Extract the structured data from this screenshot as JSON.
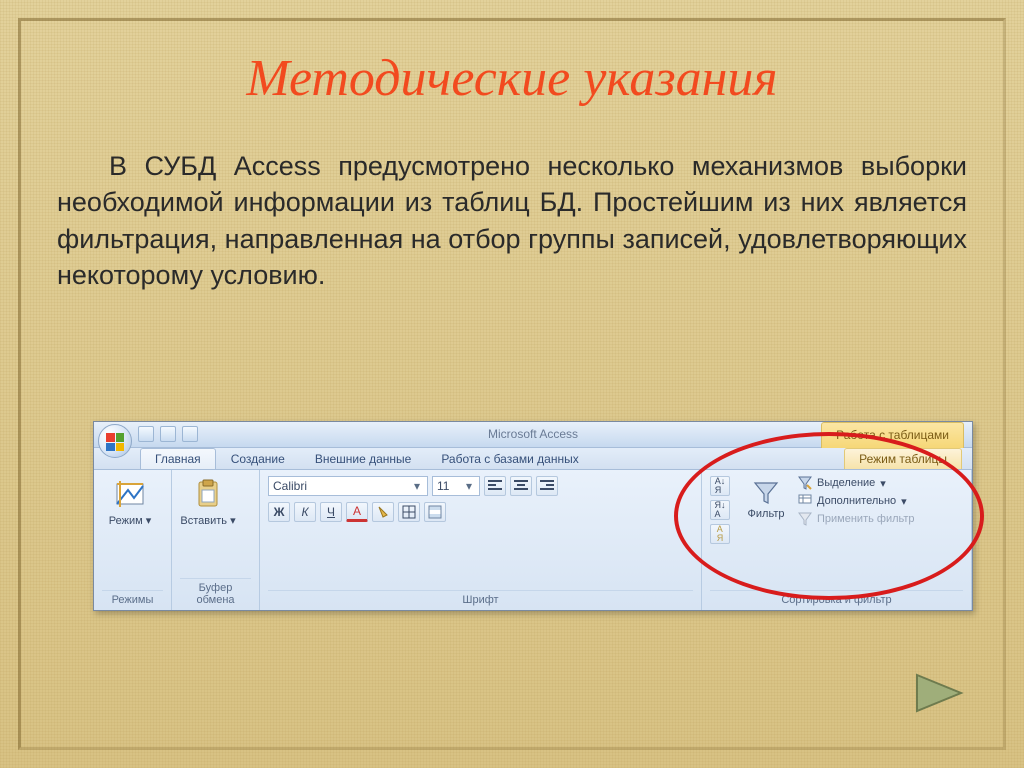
{
  "title": "Методические указания",
  "body_text": "В СУБД Access предусмотрено несколько механизмов выборки необходимой информации из таблиц БД. Простейшим из них является фильтрация, направленная на отбор группы записей, удовлетворяющих некоторому условию.",
  "ribbon": {
    "app_name": "Microsoft Access",
    "context_title": "Работа с таблицами",
    "tabs": [
      "Главная",
      "Создание",
      "Внешние данные",
      "Работа с базами данных"
    ],
    "context_tab": "Режим таблицы",
    "groups": {
      "view": {
        "label": "Режимы",
        "button": "Режим"
      },
      "clipboard": {
        "label": "Буфер обмена",
        "button": "Вставить"
      },
      "font": {
        "label": "Шрифт",
        "font_name": "Calibri",
        "font_size": "11",
        "buttons": {
          "bold": "Ж",
          "italic": "К",
          "underline": "Ч",
          "font_color": "A"
        }
      },
      "sort_filter": {
        "label": "Сортировка и фильтр",
        "filter_button": "Фильтр",
        "options": {
          "selection": "Выделение",
          "advanced": "Дополнительно",
          "apply": "Применить фильтр"
        }
      }
    }
  },
  "nav": {
    "next": "next-slide"
  }
}
